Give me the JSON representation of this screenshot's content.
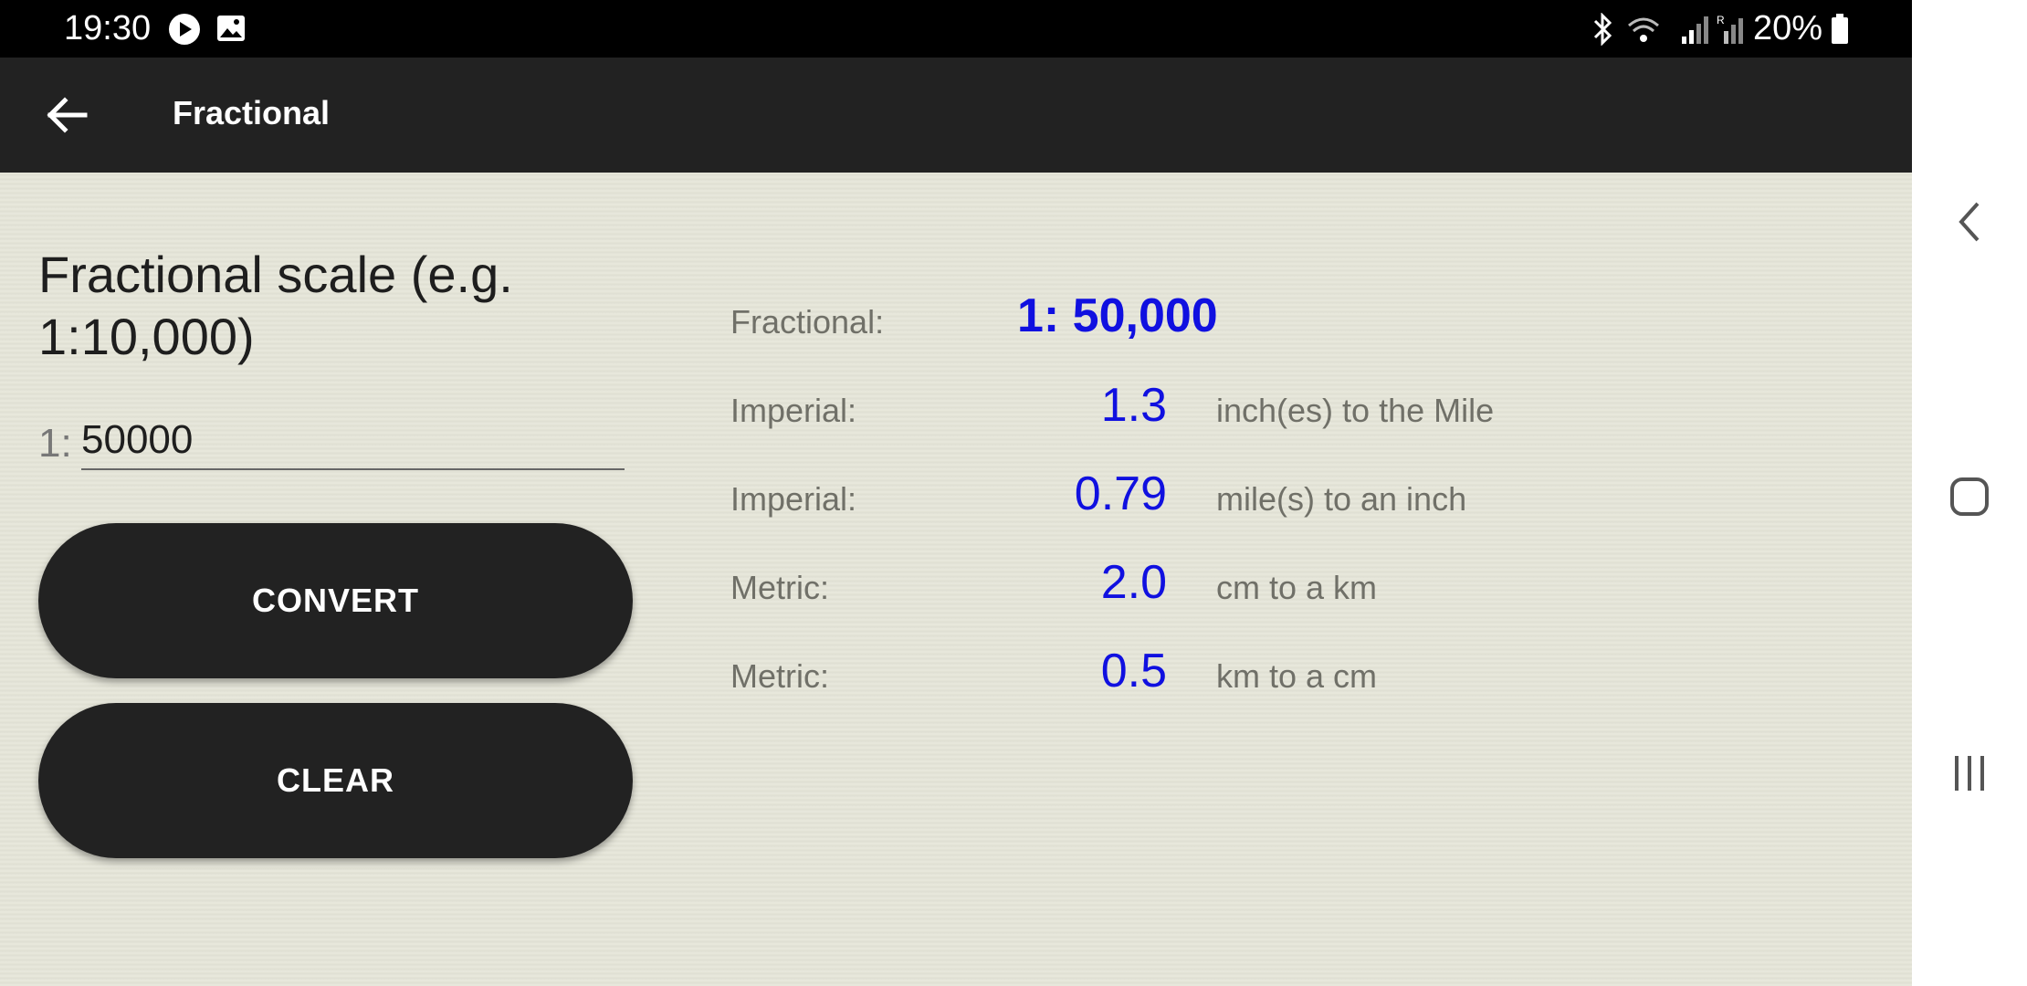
{
  "status_bar": {
    "time": "19:30",
    "battery": "20%",
    "icons": [
      "play-icon",
      "image-icon",
      "bluetooth-icon",
      "wifi-icon",
      "signal-icon",
      "signal-roaming-icon",
      "battery-icon"
    ]
  },
  "app_bar": {
    "title": "Fractional",
    "back_icon": "arrow-left-icon"
  },
  "form": {
    "prompt": "Fractional scale (e.g. 1:10,000)",
    "prefix": "1:",
    "input_value": "50000",
    "convert_label": "CONVERT",
    "clear_label": "CLEAR"
  },
  "results": {
    "fractional": {
      "label": "Fractional:",
      "value": "1: 50,000"
    },
    "rows": [
      {
        "label": "Imperial:",
        "value": "1.3",
        "unit": "inch(es) to the Mile"
      },
      {
        "label": "Imperial:",
        "value": "0.79",
        "unit": "mile(s) to an inch"
      },
      {
        "label": "Metric:",
        "value": "2.0",
        "unit": "cm to a km"
      },
      {
        "label": "Metric:",
        "value": "0.5",
        "unit": "km to a cm"
      }
    ]
  },
  "colors": {
    "app_bar": "#222222",
    "background": "#e4e4d7",
    "value_blue": "#1010e0",
    "label_gray": "#707068"
  },
  "nav_bar": {
    "icons": [
      "nav-back-icon",
      "nav-home-icon",
      "nav-recents-icon"
    ]
  }
}
